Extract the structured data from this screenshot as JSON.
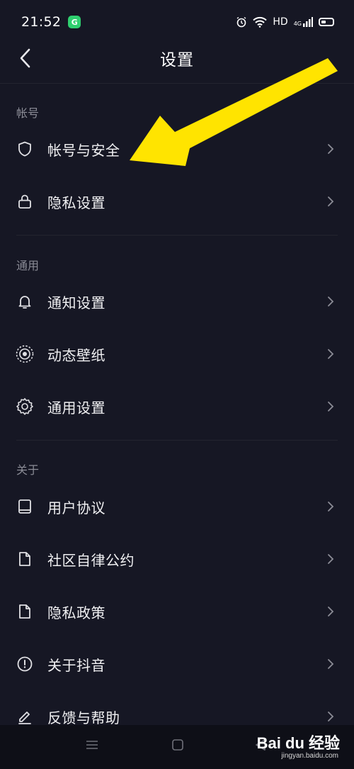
{
  "status_bar": {
    "time": "21:52",
    "app_badge": "G",
    "hd_label": "HD",
    "network": "4G"
  },
  "header": {
    "title": "设置"
  },
  "sections": [
    {
      "header": "帐号",
      "items": [
        {
          "label": "帐号与安全",
          "icon": "shield-icon"
        },
        {
          "label": "隐私设置",
          "icon": "lock-icon"
        }
      ]
    },
    {
      "header": "通用",
      "items": [
        {
          "label": "通知设置",
          "icon": "bell-icon"
        },
        {
          "label": "动态壁纸",
          "icon": "live-wallpaper-icon"
        },
        {
          "label": "通用设置",
          "icon": "gear-icon"
        }
      ]
    },
    {
      "header": "关于",
      "items": [
        {
          "label": "用户协议",
          "icon": "book-icon"
        },
        {
          "label": "社区自律公约",
          "icon": "document-icon"
        },
        {
          "label": "隐私政策",
          "icon": "document-icon"
        },
        {
          "label": "关于抖音",
          "icon": "info-icon"
        },
        {
          "label": "反馈与帮助",
          "icon": "edit-icon"
        }
      ]
    }
  ],
  "annotation": {
    "arrow_color": "#FFE400"
  },
  "watermark": {
    "logo": "Bai du 经验",
    "url": "jingyan.baidu.com"
  },
  "colors": {
    "background": "#161724",
    "navbar": "#0e0f17",
    "muted_text": "#8b8c96"
  }
}
